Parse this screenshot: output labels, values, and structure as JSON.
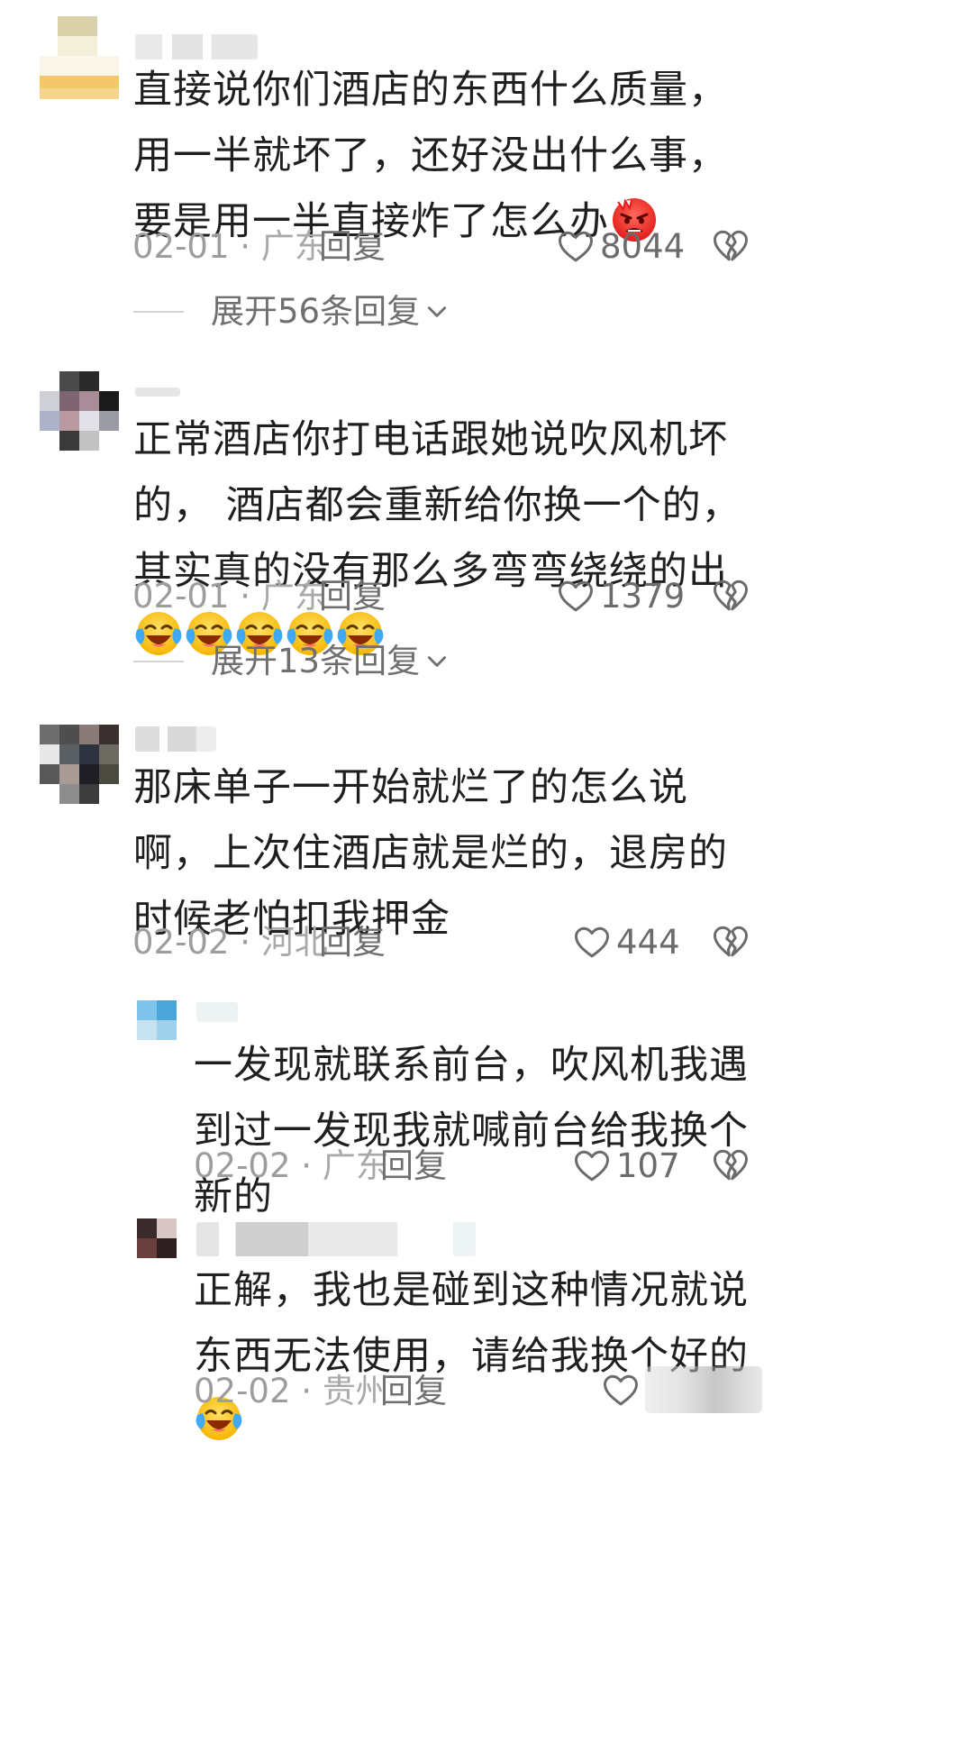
{
  "comments": [
    {
      "text": "直接说你们酒店的东西什么质量，用一半就坏了，还好没出什么事，要是用一半直接炸了怎么办",
      "emoji": "angry-face",
      "date": "02-01",
      "location": "广东",
      "reply_label": "回复",
      "likes": "8044",
      "expand_label": "展开56条回复"
    },
    {
      "text": "正常酒店你打电话跟她说吹风机坏的， 酒店都会重新给你换一个的，其实真的没有那么多弯弯绕绕的出",
      "emoji": "laughing-crying-face",
      "emoji_count": 5,
      "date": "02-01",
      "location": "广东",
      "reply_label": "回复",
      "likes": "1379",
      "expand_label": "展开13条回复"
    },
    {
      "text": "那床单子一开始就烂了的怎么说啊，上次住酒店就是烂的，退房的时候老怕扣我押金",
      "date": "02-02",
      "location": "河北",
      "reply_label": "回复",
      "likes": "444"
    }
  ],
  "replies": [
    {
      "text": "一发现就联系前台，吹风机我遇到过一发现我就喊前台给我换个新的",
      "date": "02-02",
      "location": "广东",
      "reply_label": "回复",
      "likes": "107"
    },
    {
      "text": "正解，我也是碰到这种情况就说东西无法使用，请给我换个好的",
      "emoji": "laughing-crying-face",
      "date": "02-02",
      "location": "贵州",
      "reply_label": "回复"
    }
  ],
  "icons": {
    "like": "heart-outline-icon",
    "dislike": "broken-heart-icon",
    "expand": "chevron-down-icon"
  },
  "colors": {
    "text": "#1f1f1f",
    "meta": "#9d9d9d",
    "icon": "#6b6b6b"
  }
}
